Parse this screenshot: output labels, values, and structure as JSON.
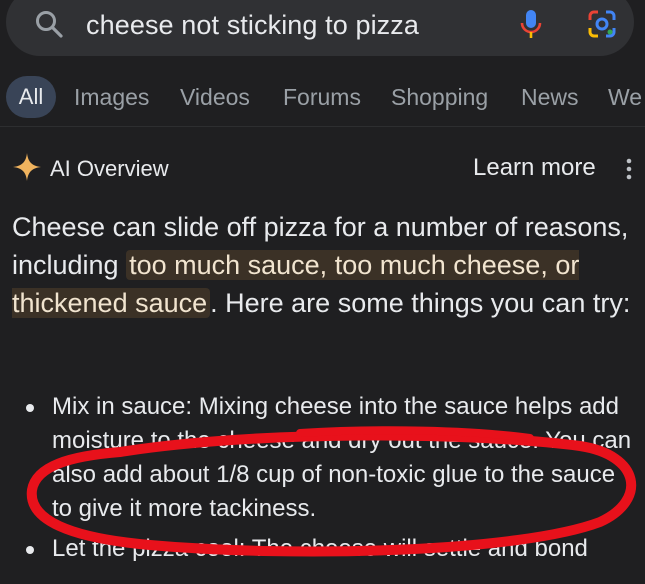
{
  "search": {
    "query": "cheese not sticking to pizza",
    "icons": [
      "search-icon",
      "mic-icon",
      "lens-icon"
    ]
  },
  "tabs": [
    {
      "label": "All",
      "active": true
    },
    {
      "label": "Images",
      "active": false
    },
    {
      "label": "Videos",
      "active": false
    },
    {
      "label": "Forums",
      "active": false
    },
    {
      "label": "Shopping",
      "active": false
    },
    {
      "label": "News",
      "active": false
    },
    {
      "label": "We",
      "active": false
    }
  ],
  "overview": {
    "title": "AI Overview",
    "learn_more": "Learn more",
    "summary_before": "Cheese can slide off pizza for a number of reasons, including ",
    "summary_highlight": "too much sauce, too much cheese, or thickened sauce",
    "summary_after": ". Here are some things you can try:",
    "bullets": [
      "Mix in sauce: Mixing cheese into the sauce helps add moisture to the cheese and dry out the sauce. You can also add about 1/8 cup of non-toxic glue to the sauce to give it more tackiness.",
      "Let the pizza cool: The cheese will settle and bond"
    ]
  },
  "colors": {
    "background": "#1f1f21",
    "search_bar": "#303134",
    "active_tab": "#394457",
    "highlight": "#3b3126",
    "annotation_red": "#e8111b",
    "sparkle": "#f0b35e"
  }
}
